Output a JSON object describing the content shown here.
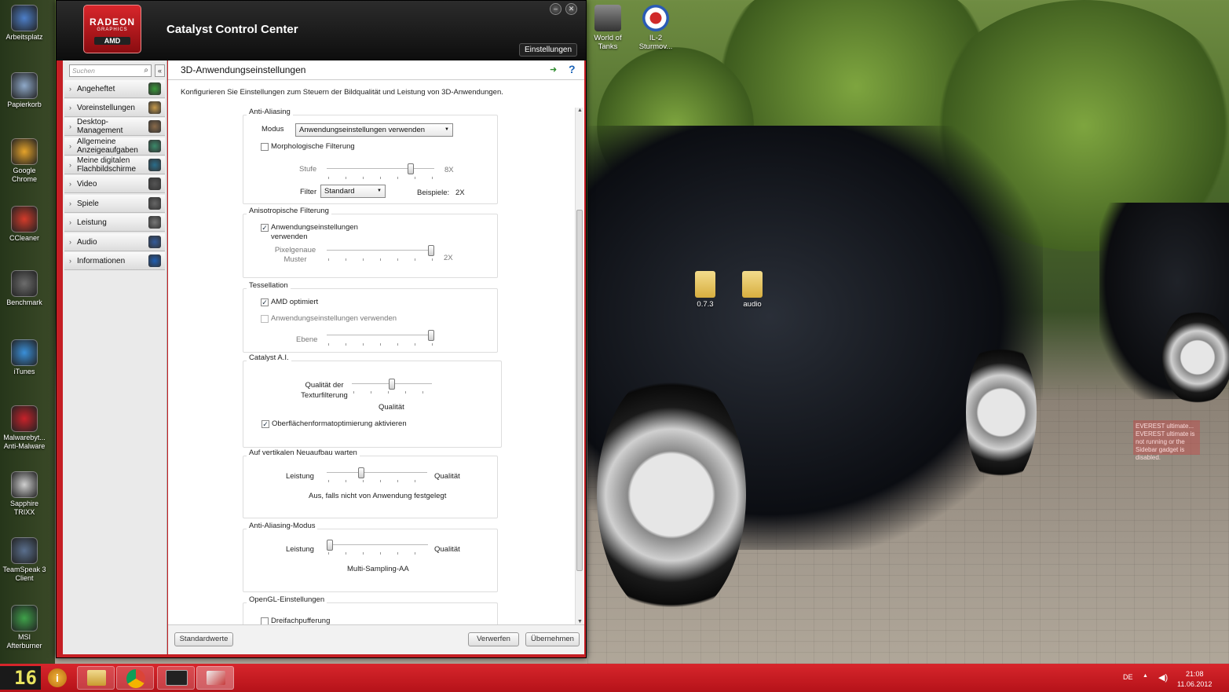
{
  "desktop": {
    "icons": [
      {
        "name": "arbeitsplatz",
        "label": "Arbeitsplatz",
        "color": "#4d7fc9"
      },
      {
        "name": "papierkorb",
        "label": "Papierkorb",
        "color": "#8fa9c9"
      },
      {
        "name": "google-chrome",
        "label": "Google Chrome",
        "color": "#e5a32a"
      },
      {
        "name": "ccleaner",
        "label": "CCleaner",
        "color": "#d33b2a"
      },
      {
        "name": "benchmark",
        "label": "Benchmark",
        "color": "#6d6d6d"
      },
      {
        "name": "itunes",
        "label": "iTunes",
        "color": "#3a8fd9"
      },
      {
        "name": "malwarebytes",
        "label": "Malwarebyt... Anti-Malware",
        "color": "#c8222a"
      },
      {
        "name": "sapphire-trixx",
        "label": "Sapphire TRIXX",
        "color": "#cfcfcf"
      },
      {
        "name": "teamspeak",
        "label": "TeamSpeak 3 Client",
        "color": "#5a6f8d"
      },
      {
        "name": "msi-afterburner",
        "label": "MSI Afterburner",
        "color": "#3fa24a"
      }
    ],
    "top_icons": [
      {
        "name": "world-of-tanks",
        "label": "World of Tanks"
      },
      {
        "name": "il2-sturmovik",
        "label": "IL-2 Sturmov..."
      }
    ],
    "folders": [
      {
        "name": "folder-073",
        "label": "0.7.3"
      },
      {
        "name": "folder-audio",
        "label": "audio"
      }
    ],
    "everest_text": "EVEREST ultimate... EVEREST ultimate is not running or the Sidebar gadget is disabled."
  },
  "window": {
    "logo_line1": "RADEON",
    "logo_line2": "GRAPHICS",
    "logo_line3": "AMD",
    "title": "Catalyst Control Center",
    "settings_button": "Einstellungen",
    "min_symbol": "–",
    "close_symbol": "✕"
  },
  "sidebar": {
    "search_placeholder": "Suchen",
    "collapse_symbol": "«",
    "items": [
      {
        "label": "Angeheftet",
        "icon_color": "#3a9b3a"
      },
      {
        "label": "Voreinstellungen",
        "icon_color": "#c79a4a"
      },
      {
        "label": "Desktop-Management",
        "icon_color": "#8a6b4a"
      },
      {
        "label": "Allgemeine Anzeigeaufgaben",
        "icon_color": "#3b8a6a"
      },
      {
        "label": "Meine digitalen Flachbildschirme",
        "icon_color": "#2a6d8a"
      },
      {
        "label": "Video",
        "icon_color": "#555555"
      },
      {
        "label": "Spiele",
        "icon_color": "#666666"
      },
      {
        "label": "Leistung",
        "icon_color": "#777777"
      },
      {
        "label": "Audio",
        "icon_color": "#335b9b"
      },
      {
        "label": "Informationen",
        "icon_color": "#1f5fb5"
      }
    ]
  },
  "content": {
    "title": "3D-Anwendungseinstellungen",
    "description": "Konfigurieren Sie Einstellungen zum Steuern der Bildqualität und Leistung von 3D-Anwendungen.",
    "anti_aliasing": {
      "label": "Anti-Aliasing",
      "modus_label": "Modus",
      "modus_value": "Anwendungseinstellungen verwenden",
      "morph_label": "Morphologische Filterung",
      "morph_checked": false,
      "stufe_label": "Stufe",
      "stufe_value": "8X",
      "stufe_level": 0.8,
      "filter_label": "Filter",
      "filter_value": "Standard",
      "beispiele_label": "Beispiele:",
      "beispiele_value": "2X"
    },
    "anisotropic": {
      "label": "Anisotropische Filterung",
      "app_settings_label": "Anwendungseinstellungen verwenden",
      "app_settings_checked": true,
      "pixel_label": "Pixelgenaue Muster",
      "pixel_value": "2X",
      "pixel_level": 1.0
    },
    "tessellation": {
      "label": "Tessellation",
      "amd_label": "AMD optimiert",
      "amd_checked": true,
      "app_label": "Anwendungseinstellungen verwenden",
      "app_checked": false,
      "ebene_label": "Ebene",
      "ebene_level": 1.0
    },
    "catalyst_ai": {
      "label": "Catalyst A.I.",
      "quality_label": "Qualität der Texturfilterung",
      "quality_value": "Qualität",
      "quality_level": 0.5,
      "surface_label": "Oberflächenformatoptimierung aktivieren",
      "surface_checked": true
    },
    "vsync": {
      "label": "Auf vertikalen Neuaufbau warten",
      "left": "Leistung",
      "right": "Qualität",
      "value": "Aus, falls nicht von Anwendung festgelegt",
      "level": 0.33
    },
    "aa_mode": {
      "label": "Anti-Aliasing-Modus",
      "left": "Leistung",
      "right": "Qualität",
      "value": "Multi-Sampling-AA",
      "level": 0.0
    },
    "opengl": {
      "label": "OpenGL-Einstellungen",
      "triple_label": "Dreifachpufferung",
      "triple_checked": false
    },
    "buttons": {
      "defaults": "Standardwerte",
      "discard": "Verwerfen",
      "apply": "Übernehmen"
    }
  },
  "taskbar": {
    "start_text": "16",
    "apps": [
      "info",
      "explorer",
      "chrome",
      "everest",
      "catalyst"
    ],
    "lang": "DE",
    "time": "21:08",
    "date": "11.06.2012"
  }
}
